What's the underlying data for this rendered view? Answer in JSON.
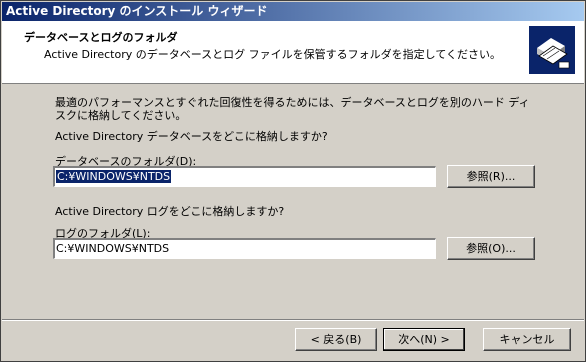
{
  "window": {
    "title": "Active Directory のインストール ウィザード"
  },
  "header": {
    "title": "データベースとログのフォルダ",
    "description": "Active Directory のデータベースとログ ファイルを保管するフォルダを指定してください。"
  },
  "body": {
    "intro": "最適のパフォーマンスとすぐれた回復性を得るためには、データベースとログを別のハード ディスクに格納してください。",
    "database_question": "Active Directory データベースをどこに格納しますか?",
    "database_label": "データベースのフォルダ(D):",
    "database_value": "C:¥WINDOWS¥NTDS",
    "log_question": "Active Directory ログをどこに格納しますか?",
    "log_label": "ログのフォルダ(L):",
    "log_value": "C:¥WINDOWS¥NTDS",
    "browse_db_label": "参照(R)...",
    "browse_log_label": "参照(O)..."
  },
  "footer": {
    "back_label": "< 戻る(B)",
    "next_label": "次へ(N) >",
    "cancel_label": "キャンセル"
  },
  "colors": {
    "title_start": "#0a246a",
    "title_end": "#a6caf0",
    "face": "#d4d0c8",
    "selection": "#0a246a"
  },
  "icons": {
    "header": "directory-book-icon"
  }
}
